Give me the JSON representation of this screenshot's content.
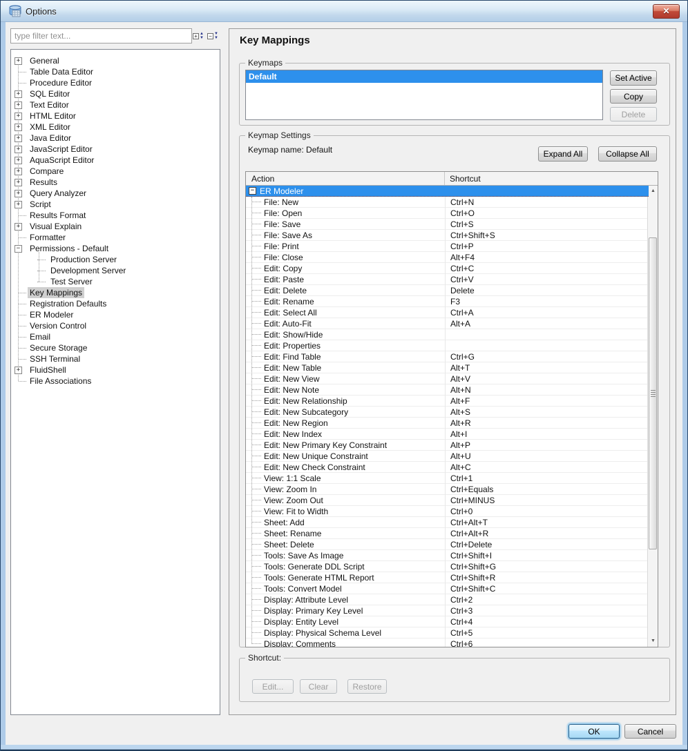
{
  "window": {
    "title": "Options"
  },
  "icons": {
    "expand": "+",
    "minus": "−",
    "close": "✕",
    "arrow_up": "▲",
    "arrow_down": "▼",
    "scroll_up": "▲",
    "scroll_down": "▼"
  },
  "colors": {
    "selection_blue": "#2d90ec",
    "titlebar_blue": "#c2d8ec",
    "close_red": "#b03a2e",
    "frame_blue": "#aecbe8",
    "inactive_selection_grey": "#cfcfcf"
  },
  "filter": {
    "placeholder": "type filter text..."
  },
  "tree": {
    "items": [
      {
        "label": "General",
        "state": "plus",
        "level": 0
      },
      {
        "label": "Table Data Editor",
        "state": "leaf",
        "level": 0
      },
      {
        "label": "Procedure Editor",
        "state": "leaf",
        "level": 0
      },
      {
        "label": "SQL Editor",
        "state": "plus",
        "level": 0
      },
      {
        "label": "Text Editor",
        "state": "plus",
        "level": 0
      },
      {
        "label": "HTML Editor",
        "state": "plus",
        "level": 0
      },
      {
        "label": "XML Editor",
        "state": "plus",
        "level": 0
      },
      {
        "label": "Java Editor",
        "state": "plus",
        "level": 0
      },
      {
        "label": "JavaScript Editor",
        "state": "plus",
        "level": 0
      },
      {
        "label": "AquaScript Editor",
        "state": "plus",
        "level": 0
      },
      {
        "label": "Compare",
        "state": "plus",
        "level": 0
      },
      {
        "label": "Results",
        "state": "plus",
        "level": 0
      },
      {
        "label": "Query Analyzer",
        "state": "plus",
        "level": 0
      },
      {
        "label": "Script",
        "state": "plus",
        "level": 0
      },
      {
        "label": "Results Format",
        "state": "leaf",
        "level": 0
      },
      {
        "label": "Visual Explain",
        "state": "plus",
        "level": 0
      },
      {
        "label": "Formatter",
        "state": "leaf",
        "level": 0
      },
      {
        "label": "Permissions - Default",
        "state": "minus",
        "level": 0
      },
      {
        "label": "Production Server",
        "state": "leaf",
        "level": 1
      },
      {
        "label": "Development Server",
        "state": "leaf",
        "level": 1
      },
      {
        "label": "Test Server",
        "state": "leaf",
        "level": 1
      },
      {
        "label": "Key Mappings",
        "state": "leaf",
        "level": 0,
        "selected": true
      },
      {
        "label": "Registration Defaults",
        "state": "leaf",
        "level": 0
      },
      {
        "label": "ER Modeler",
        "state": "leaf",
        "level": 0
      },
      {
        "label": "Version Control",
        "state": "leaf",
        "level": 0
      },
      {
        "label": "Email",
        "state": "leaf",
        "level": 0
      },
      {
        "label": "Secure Storage",
        "state": "leaf",
        "level": 0
      },
      {
        "label": "SSH Terminal",
        "state": "leaf",
        "level": 0
      },
      {
        "label": "FluidShell",
        "state": "plus",
        "level": 0
      },
      {
        "label": "File Associations",
        "state": "leaf",
        "level": 0
      }
    ]
  },
  "main": {
    "title": "Key Mappings",
    "keymaps": {
      "label": "Keymaps",
      "items": [
        {
          "name": "Default",
          "selected": true
        }
      ],
      "set_active": "Set Active",
      "copy": "Copy",
      "delete": "Delete"
    },
    "settings": {
      "label": "Keymap Settings",
      "keymap_name": "Keymap name: Default",
      "expand_all": "Expand All",
      "collapse_all": "Collapse All",
      "table": {
        "columns": [
          "Action",
          "Shortcut"
        ],
        "group": {
          "label": "ER Modeler",
          "expanded": true
        },
        "rows": [
          {
            "action": "File: New",
            "shortcut": "Ctrl+N"
          },
          {
            "action": "File: Open",
            "shortcut": "Ctrl+O"
          },
          {
            "action": "File: Save",
            "shortcut": "Ctrl+S"
          },
          {
            "action": "File: Save As",
            "shortcut": "Ctrl+Shift+S"
          },
          {
            "action": "File: Print",
            "shortcut": "Ctrl+P"
          },
          {
            "action": "File: Close",
            "shortcut": "Alt+F4"
          },
          {
            "action": "Edit: Copy",
            "shortcut": "Ctrl+C"
          },
          {
            "action": "Edit: Paste",
            "shortcut": "Ctrl+V"
          },
          {
            "action": "Edit: Delete",
            "shortcut": "Delete"
          },
          {
            "action": "Edit: Rename",
            "shortcut": "F3"
          },
          {
            "action": "Edit: Select All",
            "shortcut": "Ctrl+A"
          },
          {
            "action": "Edit: Auto-Fit",
            "shortcut": "Alt+A"
          },
          {
            "action": "Edit: Show/Hide",
            "shortcut": ""
          },
          {
            "action": "Edit: Properties",
            "shortcut": ""
          },
          {
            "action": "Edit: Find Table",
            "shortcut": "Ctrl+G"
          },
          {
            "action": "Edit: New Table",
            "shortcut": "Alt+T"
          },
          {
            "action": "Edit: New View",
            "shortcut": "Alt+V"
          },
          {
            "action": "Edit: New Note",
            "shortcut": "Alt+N"
          },
          {
            "action": "Edit: New Relationship",
            "shortcut": "Alt+F"
          },
          {
            "action": "Edit: New Subcategory",
            "shortcut": "Alt+S"
          },
          {
            "action": "Edit: New Region",
            "shortcut": "Alt+R"
          },
          {
            "action": "Edit: New Index",
            "shortcut": "Alt+I"
          },
          {
            "action": "Edit: New Primary Key Constraint",
            "shortcut": "Alt+P"
          },
          {
            "action": "Edit: New Unique Constraint",
            "shortcut": "Alt+U"
          },
          {
            "action": "Edit: New Check Constraint",
            "shortcut": "Alt+C"
          },
          {
            "action": "View: 1:1 Scale",
            "shortcut": "Ctrl+1"
          },
          {
            "action": "View: Zoom In",
            "shortcut": "Ctrl+Equals"
          },
          {
            "action": "View: Zoom Out",
            "shortcut": "Ctrl+MINUS"
          },
          {
            "action": "View: Fit to Width",
            "shortcut": "Ctrl+0"
          },
          {
            "action": "Sheet: Add",
            "shortcut": "Ctrl+Alt+T"
          },
          {
            "action": "Sheet: Rename",
            "shortcut": "Ctrl+Alt+R"
          },
          {
            "action": "Sheet: Delete",
            "shortcut": "Ctrl+Delete"
          },
          {
            "action": "Tools: Save As Image",
            "shortcut": "Ctrl+Shift+I"
          },
          {
            "action": "Tools: Generate DDL Script",
            "shortcut": "Ctrl+Shift+G"
          },
          {
            "action": "Tools: Generate HTML Report",
            "shortcut": "Ctrl+Shift+R"
          },
          {
            "action": "Tools: Convert Model",
            "shortcut": "Ctrl+Shift+C"
          },
          {
            "action": "Display: Attribute Level",
            "shortcut": "Ctrl+2"
          },
          {
            "action": "Display: Primary Key Level",
            "shortcut": "Ctrl+3"
          },
          {
            "action": "Display: Entity Level",
            "shortcut": "Ctrl+4"
          },
          {
            "action": "Display: Physical Schema Level",
            "shortcut": "Ctrl+5"
          },
          {
            "action": "Display: Comments",
            "shortcut": "Ctrl+6"
          }
        ]
      }
    },
    "shortcut_panel": {
      "label": "Shortcut:",
      "edit": "Edit...",
      "clear": "Clear",
      "restore": "Restore"
    },
    "footer": {
      "ok": "OK",
      "cancel": "Cancel"
    }
  }
}
